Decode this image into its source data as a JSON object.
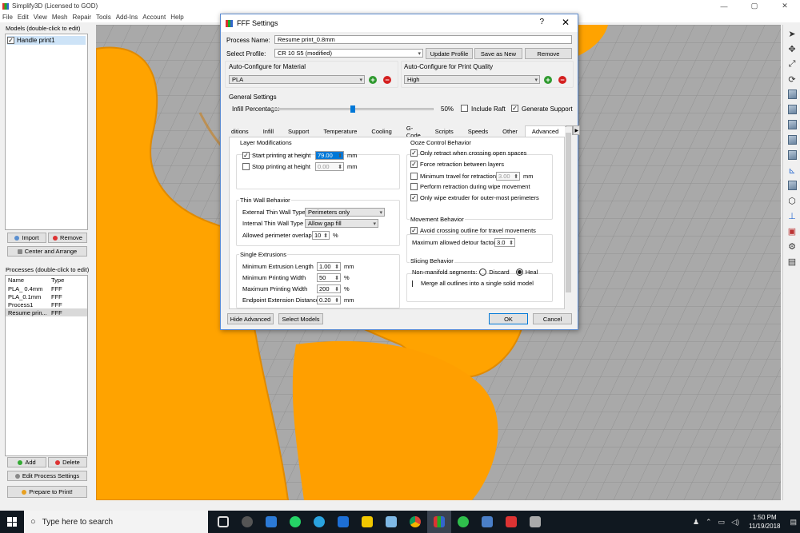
{
  "app": {
    "title": "Simplify3D (Licensed to GOD)",
    "menu": [
      "File",
      "Edit",
      "View",
      "Mesh",
      "Repair",
      "Tools",
      "Add-Ins",
      "Account",
      "Help"
    ],
    "window_controls": [
      "—",
      "▢",
      "✕"
    ]
  },
  "left": {
    "models_label": "Models (double-click to edit)",
    "models": [
      {
        "name": "Handle print1",
        "checked": "✓"
      }
    ],
    "import_label": "Import",
    "remove_label": "Remove",
    "center_label": "Center and Arrange",
    "processes_label": "Processes (double-click to edit)",
    "proc_cols": [
      "Name",
      "Type"
    ],
    "processes": [
      {
        "name": "PLA_ 0.4mm",
        "type": "FFF"
      },
      {
        "name": "PLA_0.1mm",
        "type": "FFF"
      },
      {
        "name": "Process1",
        "type": "FFF"
      },
      {
        "name": "Resume prin...",
        "type": "FFF"
      }
    ],
    "add_label": "Add",
    "delete_label": "Delete",
    "edit_process_label": "Edit Process Settings",
    "prepare_label": "Prepare to Print!"
  },
  "dialog": {
    "title": "FFF Settings",
    "help": "?",
    "close": "✕",
    "process_name_label": "Process Name:",
    "process_name": "Resume print_0.8mm",
    "select_profile_label": "Select Profile:",
    "profile": "CR 10 S5 (modified)",
    "update_profile": "Update Profile",
    "save_as_new": "Save as New",
    "remove": "Remove",
    "material_label": "Auto-Configure for Material",
    "material": "PLA",
    "quality_label": "Auto-Configure for Print Quality",
    "quality": "High",
    "general_label": "General Settings",
    "infill_label": "Infill Percentage:",
    "infill_value": "50%",
    "infill_fraction": 0.5,
    "include_raft": "Include Raft",
    "generate_support": "Generate Support",
    "support_check": "✓",
    "tabs": [
      "ditions",
      "Infill",
      "Support",
      "Temperature",
      "Cooling",
      "G-Code",
      "Scripts",
      "Speeds",
      "Other",
      "Advanced"
    ],
    "tab_nav": [
      "◀",
      "▶"
    ],
    "layer_mod": {
      "title": "Layer Modifications",
      "start_label": "Start printing at height",
      "start_check": "✓",
      "start_value": "79.00",
      "stop_label": "Stop printing at height",
      "stop_value": "0.00",
      "unit": "mm"
    },
    "thin_wall": {
      "title": "Thin Wall Behavior",
      "external_label": "External Thin Wall Type",
      "external_value": "Perimeters only",
      "internal_label": "Internal Thin Wall Type",
      "internal_value": "Allow gap fill",
      "overlap_label": "Allowed perimeter overlap",
      "overlap_value": "10",
      "overlap_unit": "%"
    },
    "single_ext": {
      "title": "Single Extrusions",
      "rows": [
        {
          "label": "Minimum Extrusion Length",
          "value": "1.00",
          "unit": "mm"
        },
        {
          "label": "Minimum Printing Width",
          "value": "50",
          "unit": "%"
        },
        {
          "label": "Maximum Printing Width",
          "value": "200",
          "unit": "%"
        },
        {
          "label": "Endpoint Extension Distance",
          "value": "0.20",
          "unit": "mm"
        }
      ]
    },
    "ooze": {
      "title": "Ooze Control Behavior",
      "rows": [
        {
          "label": "Only retract when crossing open spaces",
          "check": "✓"
        },
        {
          "label": "Force retraction between layers",
          "check": "✓"
        },
        {
          "label": "Minimum travel for retraction",
          "check": "",
          "value": "3.00",
          "unit": "mm"
        },
        {
          "label": "Perform retraction during wipe movement",
          "check": ""
        },
        {
          "label": "Only wipe extruder for outer-most perimeters",
          "check": "✓"
        }
      ]
    },
    "movement": {
      "title": "Movement Behavior",
      "avoid_label": "Avoid crossing outline for travel movements",
      "avoid_check": "✓",
      "detour_label": "Maximum allowed detour factor",
      "detour_value": "3.0"
    },
    "slicing": {
      "title": "Slicing Behavior",
      "nonmanifold_label": "Non-manifold segments:",
      "discard": "Discard",
      "heal": "Heal",
      "merge_label": "Merge all outlines into a single solid model"
    },
    "hide_advanced": "Hide Advanced",
    "select_models": "Select Models",
    "ok": "OK",
    "cancel": "Cancel"
  },
  "taskbar": {
    "search_placeholder": "Type here to search",
    "time": "1:50 PM",
    "date": "11/19/2018"
  },
  "colors": {
    "model": "#ffa300",
    "accent": "#0078d7",
    "viewport": "#a9a9a9"
  }
}
